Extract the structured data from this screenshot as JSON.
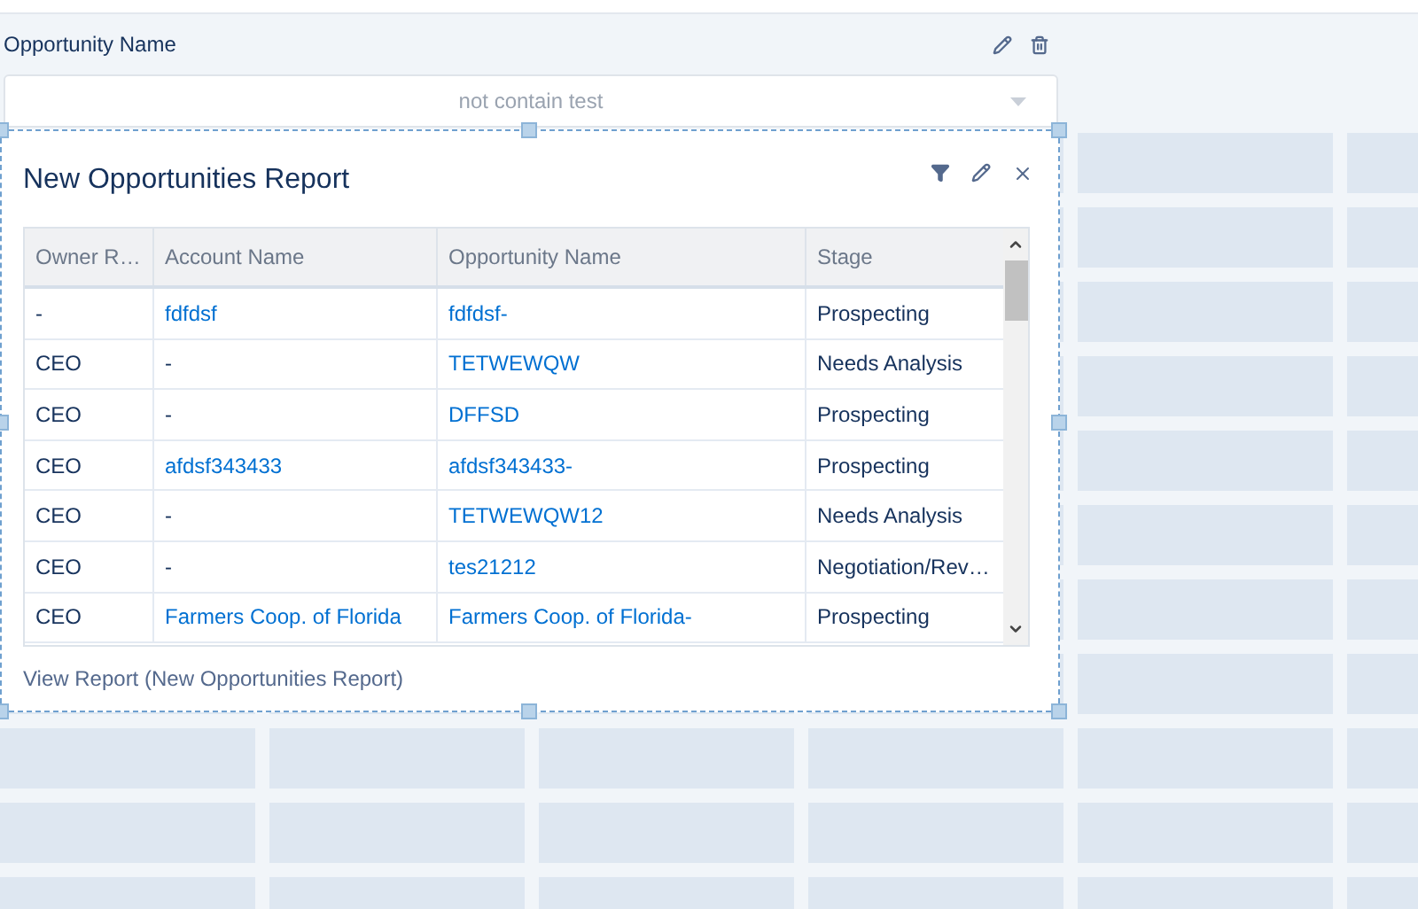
{
  "filter": {
    "label": "Opportunity Name",
    "value": "not contain test"
  },
  "report": {
    "title": "New Opportunities Report",
    "columns": [
      "Owner R…",
      "Account Name",
      "Opportunity Name",
      "Stage"
    ],
    "rows": [
      [
        {
          "text": "-",
          "kind": "text"
        },
        {
          "text": "fdfdsf",
          "kind": "link"
        },
        {
          "text": "fdfdsf-",
          "kind": "link"
        },
        {
          "text": "Prospecting",
          "kind": "text"
        }
      ],
      [
        {
          "text": "CEO",
          "kind": "text"
        },
        {
          "text": "-",
          "kind": "text"
        },
        {
          "text": "TETWEWQW",
          "kind": "link"
        },
        {
          "text": "Needs Analysis",
          "kind": "text"
        }
      ],
      [
        {
          "text": "CEO",
          "kind": "text"
        },
        {
          "text": "-",
          "kind": "text"
        },
        {
          "text": "DFFSD",
          "kind": "link"
        },
        {
          "text": "Prospecting",
          "kind": "text"
        }
      ],
      [
        {
          "text": "CEO",
          "kind": "text"
        },
        {
          "text": "afdsf343433",
          "kind": "link"
        },
        {
          "text": "afdsf343433-",
          "kind": "link"
        },
        {
          "text": "Prospecting",
          "kind": "text"
        }
      ],
      [
        {
          "text": "CEO",
          "kind": "text"
        },
        {
          "text": "-",
          "kind": "text"
        },
        {
          "text": "TETWEWQW12",
          "kind": "link"
        },
        {
          "text": "Needs Analysis",
          "kind": "text"
        }
      ],
      [
        {
          "text": "CEO",
          "kind": "text"
        },
        {
          "text": "-",
          "kind": "text"
        },
        {
          "text": "tes21212",
          "kind": "link"
        },
        {
          "text": "Negotiation/Rev…",
          "kind": "text"
        }
      ],
      [
        {
          "text": "CEO",
          "kind": "text"
        },
        {
          "text": "Farmers Coop. of Florida",
          "kind": "link"
        },
        {
          "text": "Farmers Coop. of Florida-",
          "kind": "link"
        },
        {
          "text": "Prospecting",
          "kind": "text"
        }
      ]
    ],
    "footer_link": "View Report (New Opportunities Report)"
  }
}
